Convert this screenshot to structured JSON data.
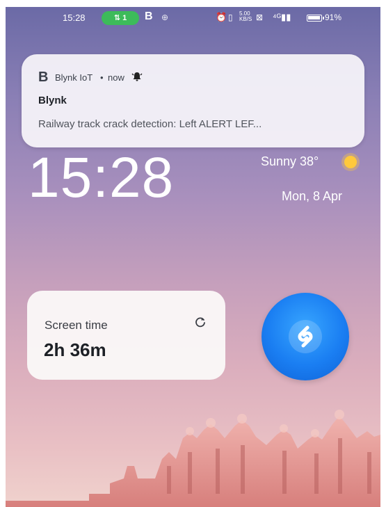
{
  "status_bar": {
    "time": "15:28",
    "hotspot": "⇅ 1",
    "app_badge": "B",
    "misc_icon": "⊕",
    "speed": "5.00 KB/S",
    "network": "⊠",
    "signal": "⁴ᴳ▮▮",
    "battery": "91%"
  },
  "notification": {
    "app_icon": "B",
    "app_name": "Blynk IoT",
    "separator": "•",
    "time": "now",
    "title": "Blynk",
    "body": "Railway track crack detection: Left ALERT LEF..."
  },
  "lock_screen": {
    "clock": "15:28",
    "weather": "Sunny 38°",
    "date": "Mon, 8 Apr"
  },
  "screen_time_widget": {
    "label": "Screen time",
    "value": "2h 36m",
    "refresh_icon": "C"
  },
  "colors": {
    "hotspot_green": "#3dbb5a",
    "shazam_blue": "#1a7ef2",
    "sun": "#ffc93c",
    "palace_pink": "#e7928f"
  },
  "icons": {
    "alarm": "alarm-icon",
    "sun": "sun-icon",
    "refresh": "refresh-icon",
    "shazam": "shazam-icon",
    "bell": "bell-icon"
  }
}
